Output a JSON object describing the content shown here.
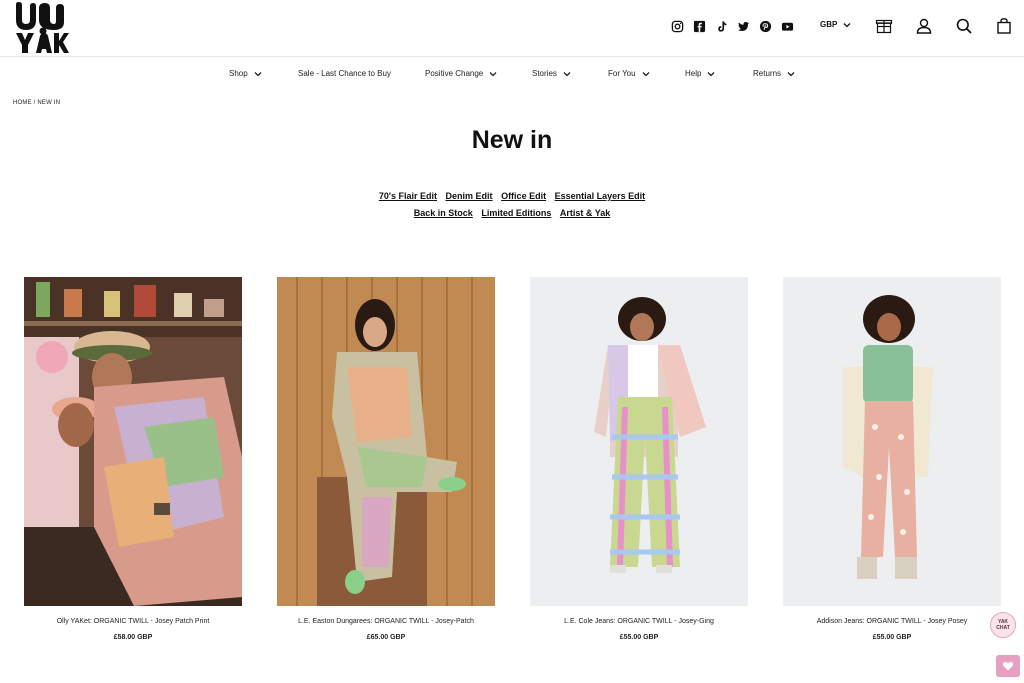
{
  "brand": {
    "logo_text": "Lucy & Yak"
  },
  "header": {
    "social_icons": [
      "instagram-icon",
      "facebook-icon",
      "tiktok-icon",
      "twitter-icon",
      "pinterest-icon",
      "youtube-icon"
    ],
    "currency": "GBP",
    "action_icons": [
      "gift-icon",
      "account-icon",
      "search-icon",
      "bag-icon"
    ]
  },
  "nav": {
    "items": [
      {
        "label": "Shop",
        "dropdown": true
      },
      {
        "label": "Sale - Last Chance to Buy",
        "dropdown": false
      },
      {
        "label": "Positive Change",
        "dropdown": true
      },
      {
        "label": "Stories",
        "dropdown": true
      },
      {
        "label": "For You",
        "dropdown": true
      },
      {
        "label": "Help",
        "dropdown": true
      },
      {
        "label": "Returns",
        "dropdown": true
      }
    ]
  },
  "breadcrumb": "HOME / NEW IN",
  "page": {
    "title": "New in"
  },
  "edits": {
    "row1": [
      "70's Flair Edit",
      "Denim Edit",
      "Office Edit",
      "Essential Layers Edit"
    ],
    "row2": [
      "Back in Stock",
      "Limited Editions",
      "Artist & Yak"
    ]
  },
  "products": [
    {
      "name": "Olly YAKet: ORGANIC TWILL - Josey Patch Print",
      "price": "£58.00 GBP"
    },
    {
      "name": "L.E. Easton Dungarees: ORGANIC TWILL - Josey-Patch",
      "price": "£65.00 GBP"
    },
    {
      "name": "L.E. Cole Jeans: ORGANIC TWILL - Josey-Ging",
      "price": "£55.00 GBP"
    },
    {
      "name": "Addison Jeans: ORGANIC TWILL - Josey Posey",
      "price": "£55.00 GBP"
    }
  ],
  "floating": {
    "badge_text": "YAK CHAT"
  },
  "colors": {
    "text": "#111111",
    "wishlist_bg": "#e8a0c0",
    "badge_bg": "#fbe3ea"
  }
}
